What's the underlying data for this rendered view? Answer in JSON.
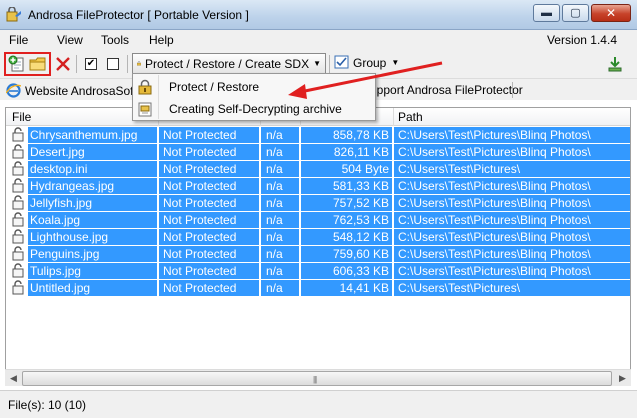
{
  "window": {
    "title": "Androsa FileProtector [ Portable Version ]",
    "minimize_glyph": "▬",
    "maximize_glyph": "▢",
    "close_glyph": "✕"
  },
  "menu": {
    "items": [
      "File",
      "View",
      "Tools",
      "Help"
    ],
    "version": "Version 1.4.4"
  },
  "toolbar": {
    "protect_dropdown_label": "Protect / Restore / Create SDX",
    "group_label": "Group",
    "check_mark": "✔"
  },
  "linkbar": {
    "website_label": "Website AndrosaSoft",
    "support_label": "Support Androsa FileProtector"
  },
  "dropdown": {
    "items": [
      {
        "label": "Protect / Restore",
        "icon": "lock-icon"
      },
      {
        "label": "Creating Self-Decrypting archive",
        "icon": "archive-icon"
      }
    ]
  },
  "table": {
    "columns": [
      "File",
      "",
      "",
      "",
      "Path"
    ],
    "rows": [
      {
        "file": "Chrysanthemum.jpg",
        "status": "Not Protected",
        "na": "n/a",
        "size": "858,78 KB",
        "path": "C:\\Users\\Test\\Pictures\\Blinq Photos\\"
      },
      {
        "file": "Desert.jpg",
        "status": "Not Protected",
        "na": "n/a",
        "size": "826,11 KB",
        "path": "C:\\Users\\Test\\Pictures\\Blinq Photos\\"
      },
      {
        "file": "desktop.ini",
        "status": "Not Protected",
        "na": "n/a",
        "size": "504 Byte",
        "path": "C:\\Users\\Test\\Pictures\\"
      },
      {
        "file": "Hydrangeas.jpg",
        "status": "Not Protected",
        "na": "n/a",
        "size": "581,33 KB",
        "path": "C:\\Users\\Test\\Pictures\\Blinq Photos\\"
      },
      {
        "file": "Jellyfish.jpg",
        "status": "Not Protected",
        "na": "n/a",
        "size": "757,52 KB",
        "path": "C:\\Users\\Test\\Pictures\\Blinq Photos\\"
      },
      {
        "file": "Koala.jpg",
        "status": "Not Protected",
        "na": "n/a",
        "size": "762,53 KB",
        "path": "C:\\Users\\Test\\Pictures\\Blinq Photos\\"
      },
      {
        "file": "Lighthouse.jpg",
        "status": "Not Protected",
        "na": "n/a",
        "size": "548,12 KB",
        "path": "C:\\Users\\Test\\Pictures\\Blinq Photos\\"
      },
      {
        "file": "Penguins.jpg",
        "status": "Not Protected",
        "na": "n/a",
        "size": "759,60 KB",
        "path": "C:\\Users\\Test\\Pictures\\Blinq Photos\\"
      },
      {
        "file": "Tulips.jpg",
        "status": "Not Protected",
        "na": "n/a",
        "size": "606,33 KB",
        "path": "C:\\Users\\Test\\Pictures\\Blinq Photos\\"
      },
      {
        "file": "Untitled.jpg",
        "status": "Not Protected",
        "na": "n/a",
        "size": "14,41 KB",
        "path": "C:\\Users\\Test\\Pictures\\"
      }
    ]
  },
  "scrollbar": {
    "grip": "|||"
  },
  "status": {
    "text": "File(s): 10 (10)"
  },
  "colors": {
    "selection": "#3399ff",
    "highlight_box": "#e02020",
    "annotation_arrow": "#e02020"
  }
}
